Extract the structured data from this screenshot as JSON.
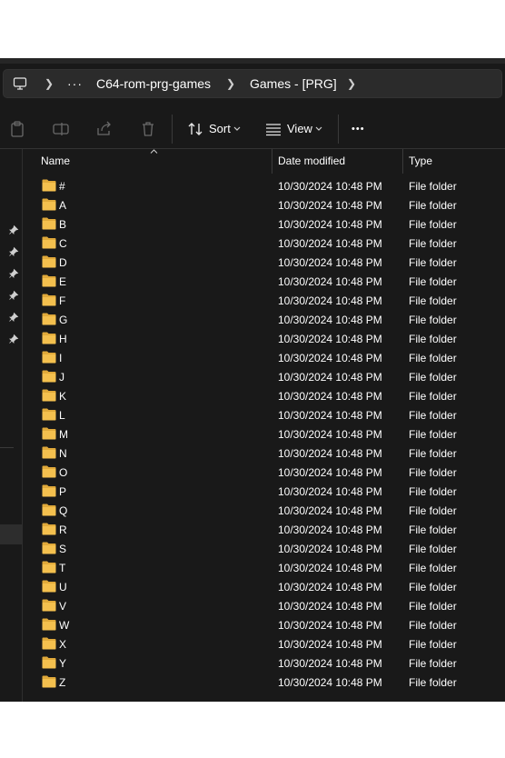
{
  "address_bar": {
    "ellipsis": "···",
    "crumbs": [
      "C64-rom-prg-games",
      "Games - [PRG]"
    ]
  },
  "toolbar": {
    "sort_label": "Sort",
    "view_label": "View",
    "more_label": "•••"
  },
  "columns": {
    "name": "Name",
    "date_modified": "Date modified",
    "type": "Type"
  },
  "files": [
    {
      "name": "#",
      "date": "10/30/2024 10:48 PM",
      "type": "File folder"
    },
    {
      "name": "A",
      "date": "10/30/2024 10:48 PM",
      "type": "File folder"
    },
    {
      "name": "B",
      "date": "10/30/2024 10:48 PM",
      "type": "File folder"
    },
    {
      "name": "C",
      "date": "10/30/2024 10:48 PM",
      "type": "File folder"
    },
    {
      "name": "D",
      "date": "10/30/2024 10:48 PM",
      "type": "File folder"
    },
    {
      "name": "E",
      "date": "10/30/2024 10:48 PM",
      "type": "File folder"
    },
    {
      "name": "F",
      "date": "10/30/2024 10:48 PM",
      "type": "File folder"
    },
    {
      "name": "G",
      "date": "10/30/2024 10:48 PM",
      "type": "File folder"
    },
    {
      "name": "H",
      "date": "10/30/2024 10:48 PM",
      "type": "File folder"
    },
    {
      "name": "I",
      "date": "10/30/2024 10:48 PM",
      "type": "File folder"
    },
    {
      "name": "J",
      "date": "10/30/2024 10:48 PM",
      "type": "File folder"
    },
    {
      "name": "K",
      "date": "10/30/2024 10:48 PM",
      "type": "File folder"
    },
    {
      "name": "L",
      "date": "10/30/2024 10:48 PM",
      "type": "File folder"
    },
    {
      "name": "M",
      "date": "10/30/2024 10:48 PM",
      "type": "File folder"
    },
    {
      "name": "N",
      "date": "10/30/2024 10:48 PM",
      "type": "File folder"
    },
    {
      "name": "O",
      "date": "10/30/2024 10:48 PM",
      "type": "File folder"
    },
    {
      "name": "P",
      "date": "10/30/2024 10:48 PM",
      "type": "File folder"
    },
    {
      "name": "Q",
      "date": "10/30/2024 10:48 PM",
      "type": "File folder"
    },
    {
      "name": "R",
      "date": "10/30/2024 10:48 PM",
      "type": "File folder"
    },
    {
      "name": "S",
      "date": "10/30/2024 10:48 PM",
      "type": "File folder"
    },
    {
      "name": "T",
      "date": "10/30/2024 10:48 PM",
      "type": "File folder"
    },
    {
      "name": "U",
      "date": "10/30/2024 10:48 PM",
      "type": "File folder"
    },
    {
      "name": "V",
      "date": "10/30/2024 10:48 PM",
      "type": "File folder"
    },
    {
      "name": "W",
      "date": "10/30/2024 10:48 PM",
      "type": "File folder"
    },
    {
      "name": "X",
      "date": "10/30/2024 10:48 PM",
      "type": "File folder"
    },
    {
      "name": "Y",
      "date": "10/30/2024 10:48 PM",
      "type": "File folder"
    },
    {
      "name": "Z",
      "date": "10/30/2024 10:48 PM",
      "type": "File folder"
    }
  ],
  "colors": {
    "window_bg": "#191919",
    "address_bg": "#2b2b2b",
    "folder": "#f4c04e",
    "folder_dark": "#e0a93a",
    "sidebar_selected": "#2d2d2d"
  },
  "icons": {
    "address": [
      "computer-icon",
      "chevron-right-icon",
      "more-horizontal-icon"
    ],
    "toolbar": [
      "paste-icon",
      "rename-icon",
      "share-icon",
      "delete-icon",
      "sort-icon",
      "view-icon",
      "more-icon"
    ],
    "sidebar": [
      "pin-icon"
    ],
    "rows": "folder-icon"
  }
}
